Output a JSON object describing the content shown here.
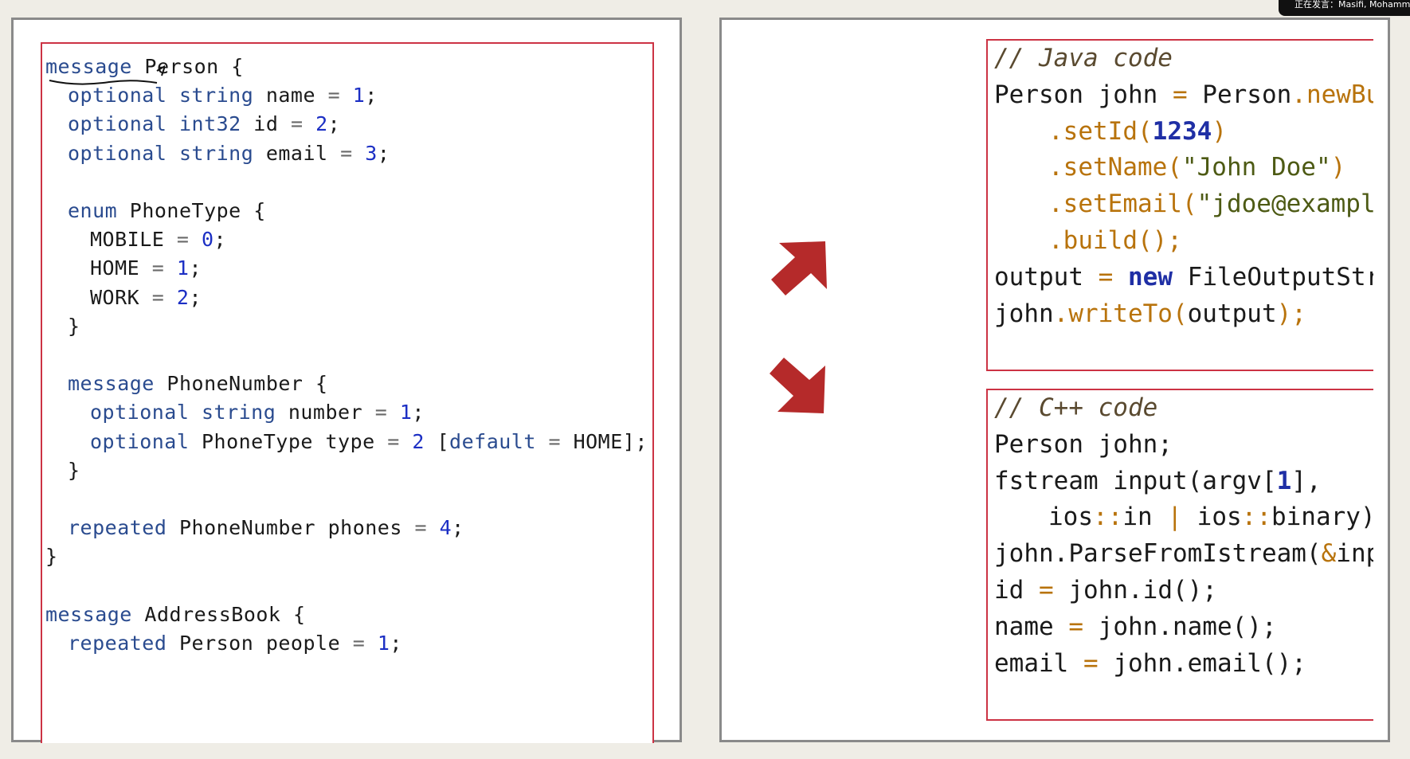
{
  "top_bar": {
    "speaking_label": "正在发言：Masifi, Mohamm"
  },
  "proto": {
    "lines": [
      {
        "t": "message",
        "k": "kw"
      },
      {
        "t": " Person {"
      },
      {
        "t": "optional string",
        "k": "kw"
      },
      {
        "t": " name "
      },
      {
        "t": "=",
        "k": "op"
      },
      {
        "t": " "
      },
      {
        "t": "1",
        "k": "num"
      },
      {
        "t": ";"
      },
      {
        "t": "optional int32",
        "k": "kw"
      },
      {
        "t": " id "
      },
      {
        "t": "=",
        "k": "op"
      },
      {
        "t": " "
      },
      {
        "t": "2",
        "k": "num"
      },
      {
        "t": ";"
      },
      {
        "t": "optional string",
        "k": "kw"
      },
      {
        "t": " email "
      },
      {
        "t": "=",
        "k": "op"
      },
      {
        "t": " "
      },
      {
        "t": "3",
        "k": "num"
      },
      {
        "t": ";"
      },
      {
        "t": "enum",
        "k": "kw"
      },
      {
        "t": " PhoneType {"
      },
      {
        "t": "MOBILE "
      },
      {
        "t": "=",
        "k": "op"
      },
      {
        "t": " "
      },
      {
        "t": "0",
        "k": "num"
      },
      {
        "t": ";"
      },
      {
        "t": "HOME "
      },
      {
        "t": "=",
        "k": "op"
      },
      {
        "t": " "
      },
      {
        "t": "1",
        "k": "num"
      },
      {
        "t": ";"
      },
      {
        "t": "WORK "
      },
      {
        "t": "=",
        "k": "op"
      },
      {
        "t": " "
      },
      {
        "t": "2",
        "k": "num"
      },
      {
        "t": ";"
      },
      {
        "t": "}"
      },
      {
        "t": "message",
        "k": "kw"
      },
      {
        "t": " PhoneNumber {"
      },
      {
        "t": "optional string",
        "k": "kw"
      },
      {
        "t": " number "
      },
      {
        "t": "=",
        "k": "op"
      },
      {
        "t": " "
      },
      {
        "t": "1",
        "k": "num"
      },
      {
        "t": ";"
      },
      {
        "t": "optional",
        "k": "kw"
      },
      {
        "t": " PhoneType type "
      },
      {
        "t": "=",
        "k": "op"
      },
      {
        "t": " "
      },
      {
        "t": "2",
        "k": "num"
      },
      {
        "t": " ["
      },
      {
        "t": "default",
        "k": "kw"
      },
      {
        "t": " "
      },
      {
        "t": "=",
        "k": "op"
      },
      {
        "t": " HOME];"
      },
      {
        "t": "}"
      },
      {
        "t": "repeated",
        "k": "kw"
      },
      {
        "t": " PhoneNumber phones "
      },
      {
        "t": "=",
        "k": "op"
      },
      {
        "t": " "
      },
      {
        "t": "4",
        "k": "num"
      },
      {
        "t": ";"
      },
      {
        "t": "}"
      },
      {
        "t": "message",
        "k": "kw"
      },
      {
        "t": " AddressBook {"
      },
      {
        "t": "repeated",
        "k": "kw"
      },
      {
        "t": " Person people "
      },
      {
        "t": "=",
        "k": "op"
      },
      {
        "t": " "
      },
      {
        "t": "1",
        "k": "num"
      },
      {
        "t": ";"
      }
    ]
  },
  "proto_rows": [
    {
      "indent": 0,
      "spans": [
        0,
        1
      ]
    },
    {
      "indent": 1,
      "spans": [
        2,
        3,
        4,
        5,
        6,
        7
      ]
    },
    {
      "indent": 1,
      "spans": [
        8,
        9,
        10,
        11,
        12,
        13
      ]
    },
    {
      "indent": 1,
      "spans": [
        14,
        15,
        16,
        17,
        18,
        19
      ]
    },
    {
      "indent": 1,
      "spans": []
    },
    {
      "indent": 1,
      "spans": [
        20,
        21
      ]
    },
    {
      "indent": 2,
      "spans": [
        22,
        23,
        24,
        25,
        26
      ]
    },
    {
      "indent": 2,
      "spans": [
        27,
        28,
        29,
        30,
        31
      ]
    },
    {
      "indent": 2,
      "spans": [
        32,
        33,
        34,
        35,
        36
      ]
    },
    {
      "indent": 1,
      "spans": [
        37
      ]
    },
    {
      "indent": 1,
      "spans": []
    },
    {
      "indent": 1,
      "spans": [
        38,
        39
      ]
    },
    {
      "indent": 2,
      "spans": [
        40,
        41,
        42,
        43,
        44,
        45
      ]
    },
    {
      "indent": 2,
      "spans": [
        46,
        47,
        48,
        49,
        50,
        51,
        52,
        53,
        54,
        55
      ]
    },
    {
      "indent": 1,
      "spans": [
        56
      ]
    },
    {
      "indent": 1,
      "spans": []
    },
    {
      "indent": 1,
      "spans": [
        57,
        58,
        59,
        60,
        61,
        62
      ]
    },
    {
      "indent": 0,
      "spans": [
        63
      ]
    },
    {
      "indent": 0,
      "spans": []
    },
    {
      "indent": 0,
      "spans": [
        64,
        65
      ]
    },
    {
      "indent": 1,
      "spans": [
        66,
        67,
        68,
        69,
        70,
        71
      ]
    }
  ],
  "java": {
    "rows": [
      {
        "indent": 0,
        "spans": [
          {
            "t": "// Java code",
            "k": "cm"
          }
        ]
      },
      {
        "indent": 0,
        "spans": [
          {
            "t": "Person john "
          },
          {
            "t": "=",
            "k": "jop"
          },
          {
            "t": " Person"
          },
          {
            "t": ".newBu",
            "k": "meth"
          }
        ]
      },
      {
        "indent": 2,
        "spans": [
          {
            "t": ".setId(",
            "k": "meth"
          },
          {
            "t": "1234",
            "k": "jnum"
          },
          {
            "t": ")",
            "k": "meth"
          }
        ]
      },
      {
        "indent": 2,
        "spans": [
          {
            "t": ".setName(",
            "k": "meth"
          },
          {
            "t": "\"John Doe\"",
            "k": "str"
          },
          {
            "t": ")",
            "k": "meth"
          }
        ]
      },
      {
        "indent": 2,
        "spans": [
          {
            "t": ".setEmail(",
            "k": "meth"
          },
          {
            "t": "\"jdoe@exampl",
            "k": "str"
          }
        ]
      },
      {
        "indent": 2,
        "spans": [
          {
            "t": ".build();",
            "k": "meth"
          }
        ]
      },
      {
        "indent": 0,
        "spans": [
          {
            "t": "output "
          },
          {
            "t": "=",
            "k": "jop"
          },
          {
            "t": " "
          },
          {
            "t": "new",
            "k": "jkw"
          },
          {
            "t": " FileOutputStr"
          }
        ]
      },
      {
        "indent": 0,
        "spans": [
          {
            "t": "john"
          },
          {
            "t": ".writeTo(",
            "k": "meth"
          },
          {
            "t": "output"
          },
          {
            "t": ");",
            "k": "meth"
          }
        ]
      }
    ]
  },
  "cpp": {
    "rows": [
      {
        "indent": 0,
        "spans": [
          {
            "t": "// C++ code",
            "k": "cm"
          }
        ]
      },
      {
        "indent": 0,
        "spans": [
          {
            "t": "Person john;"
          }
        ]
      },
      {
        "indent": 0,
        "spans": [
          {
            "t": "fstream input(argv["
          },
          {
            "t": "1",
            "k": "jnum"
          },
          {
            "t": "],"
          }
        ]
      },
      {
        "indent": 2,
        "spans": [
          {
            "t": "ios"
          },
          {
            "t": "::",
            "k": "cop"
          },
          {
            "t": "in "
          },
          {
            "t": "|",
            "k": "cop"
          },
          {
            "t": " ios"
          },
          {
            "t": "::",
            "k": "cop"
          },
          {
            "t": "binary)"
          }
        ]
      },
      {
        "indent": 0,
        "spans": [
          {
            "t": "john.ParseFromIstream("
          },
          {
            "t": "&",
            "k": "cop"
          },
          {
            "t": "inp"
          }
        ]
      },
      {
        "indent": 0,
        "spans": [
          {
            "t": "id "
          },
          {
            "t": "=",
            "k": "cop"
          },
          {
            "t": " john.id();"
          }
        ]
      },
      {
        "indent": 0,
        "spans": [
          {
            "t": "name "
          },
          {
            "t": "=",
            "k": "cop"
          },
          {
            "t": " john.name();"
          }
        ]
      },
      {
        "indent": 0,
        "spans": [
          {
            "t": "email "
          },
          {
            "t": "=",
            "k": "cop"
          },
          {
            "t": " john.email();"
          }
        ]
      }
    ]
  },
  "colors": {
    "arrow": "#b52a2a",
    "box_border": "#cc3344"
  }
}
